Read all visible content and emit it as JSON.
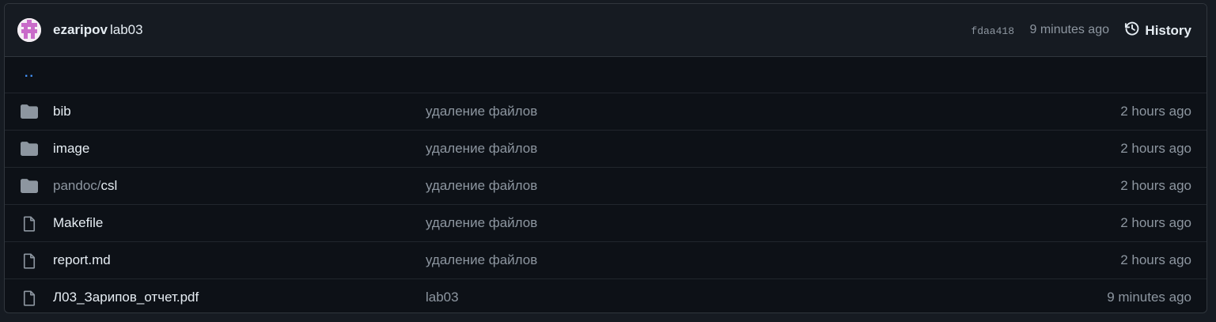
{
  "header": {
    "author": "ezaripov",
    "message": "lab03",
    "sha": "fdaa418",
    "time": "9 minutes ago",
    "history_label": "History"
  },
  "parent_link": "..",
  "files": [
    {
      "type": "folder",
      "name": "bib",
      "name_prefix": "",
      "commit": "удаление файлов",
      "age": "2 hours ago"
    },
    {
      "type": "folder",
      "name": "image",
      "name_prefix": "",
      "commit": "удаление файлов",
      "age": "2 hours ago"
    },
    {
      "type": "folder",
      "name": "csl",
      "name_prefix": "pandoc/",
      "commit": "удаление файлов",
      "age": "2 hours ago"
    },
    {
      "type": "file",
      "name": "Makefile",
      "name_prefix": "",
      "commit": "удаление файлов",
      "age": "2 hours ago"
    },
    {
      "type": "file",
      "name": "report.md",
      "name_prefix": "",
      "commit": "удаление файлов",
      "age": "2 hours ago"
    },
    {
      "type": "file",
      "name": "Л03_Зарипов_отчет.pdf",
      "name_prefix": "",
      "commit": "lab03",
      "age": "9 minutes ago"
    }
  ],
  "colors": {
    "background": "#0d1117",
    "header_bg": "#161b22",
    "border": "#30363d",
    "text": "#e6edf3",
    "muted": "#8d96a0",
    "link": "#4493f8",
    "icon": "#8d96a0"
  }
}
